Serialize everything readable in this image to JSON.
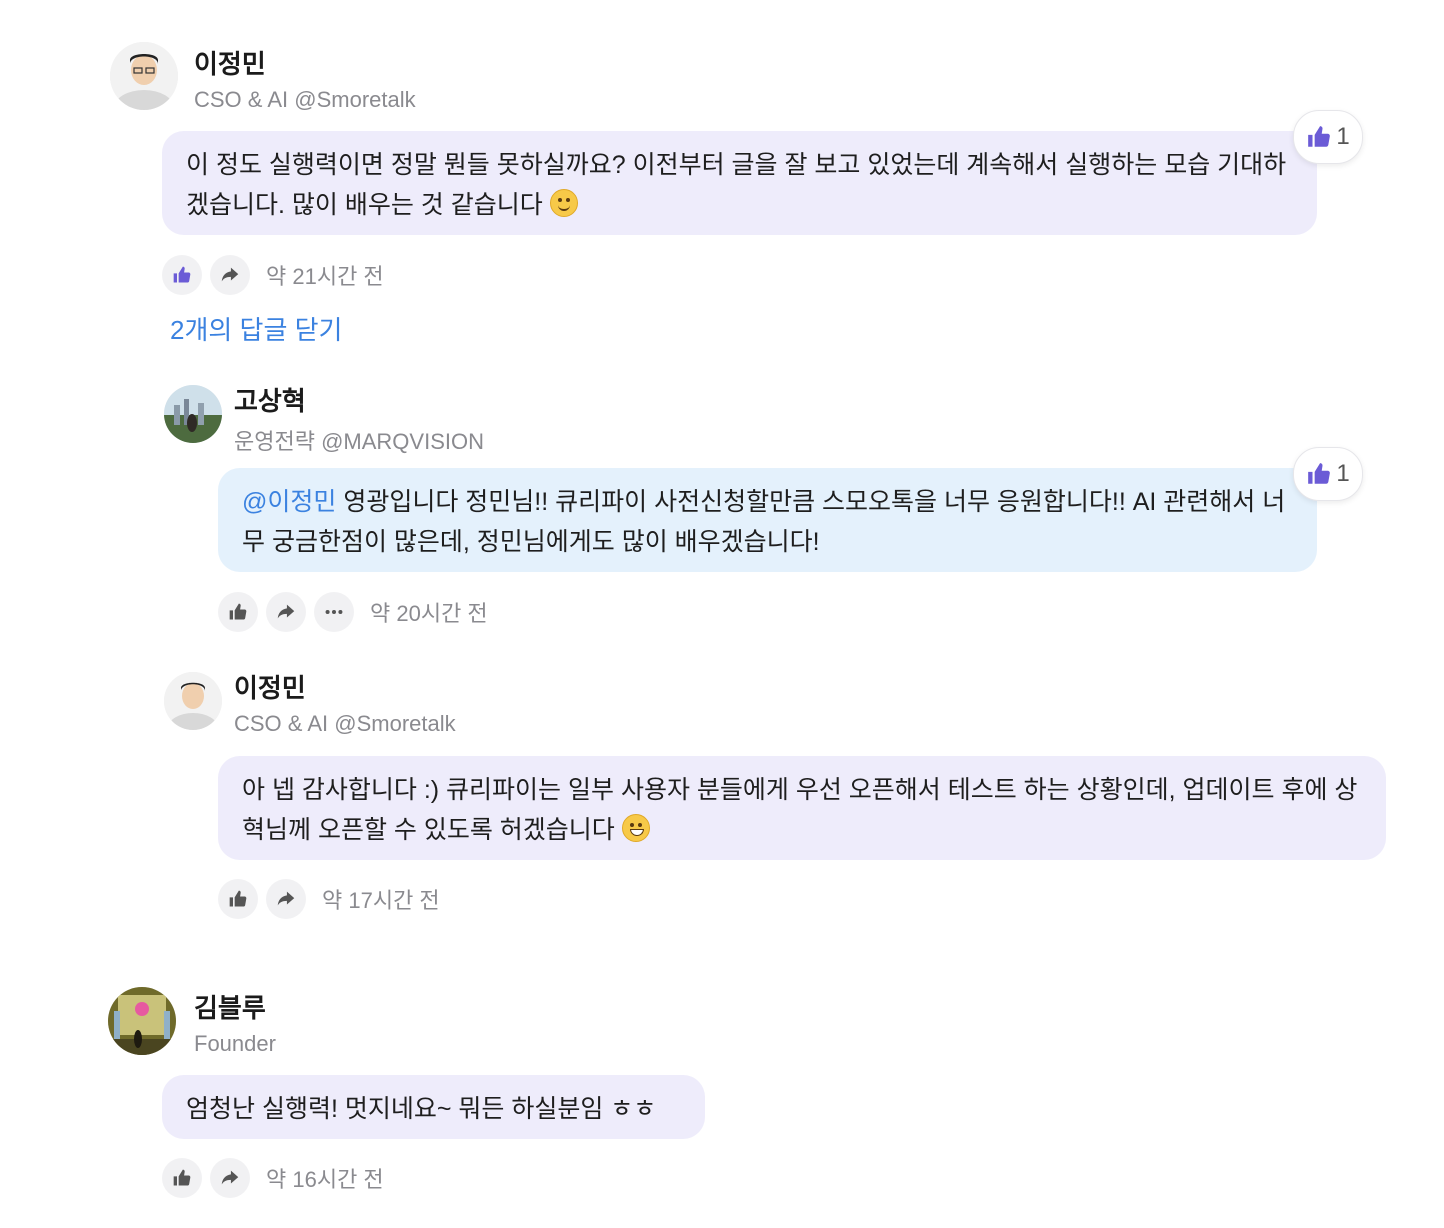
{
  "comments": [
    {
      "author": "이정민",
      "role": "CSO & AI @Smoretalk",
      "text": "이 정도 실행력이면 정말 뭔들 못하실까요? 이전부터 글을 잘 보고 있었는데 계속해서 실행하는 모습 기대하겠습니다. 많이 배우는 것 같습니다",
      "likes": "1",
      "time": "약 21시간 전",
      "emoji": "smiling-face"
    },
    {
      "author": "김블루",
      "role": "Founder",
      "text": "엄청난 실행력! 멋지네요~ 뭐든 하실분임 ㅎㅎ",
      "time": "약 16시간 전"
    }
  ],
  "replies_toggle": "2개의 답글 닫기",
  "replies": [
    {
      "author": "고상혁",
      "role": "운영전략 @MARQVISION",
      "mention": "@이정민",
      "text": " 영광입니다 정민님!! 큐리파이 사전신청할만큼 스모오톡을 너무 응원합니다!! AI 관련해서 너무 궁금한점이 많은데, 정민님에게도 많이 배우겠습니다!",
      "likes": "1",
      "time": "약 20시간 전"
    },
    {
      "author": "이정민",
      "role": "CSO & AI @Smoretalk",
      "text": "아 넵 감사합니다 :) 큐리파이는 일부 사용자 분들에게 우선 오픈해서 테스트 하는 상황인데, 업데이트 후에 상혁님께 오픈할 수 있도록 허겠습니다",
      "time": "약 17시간 전",
      "emoji": "grinning-face"
    }
  ],
  "colors": {
    "accent": "#3b82e0",
    "like_active": "#6b5bd6",
    "bubble_purple": "#eeecfb",
    "bubble_blue": "#e4f1fc"
  }
}
